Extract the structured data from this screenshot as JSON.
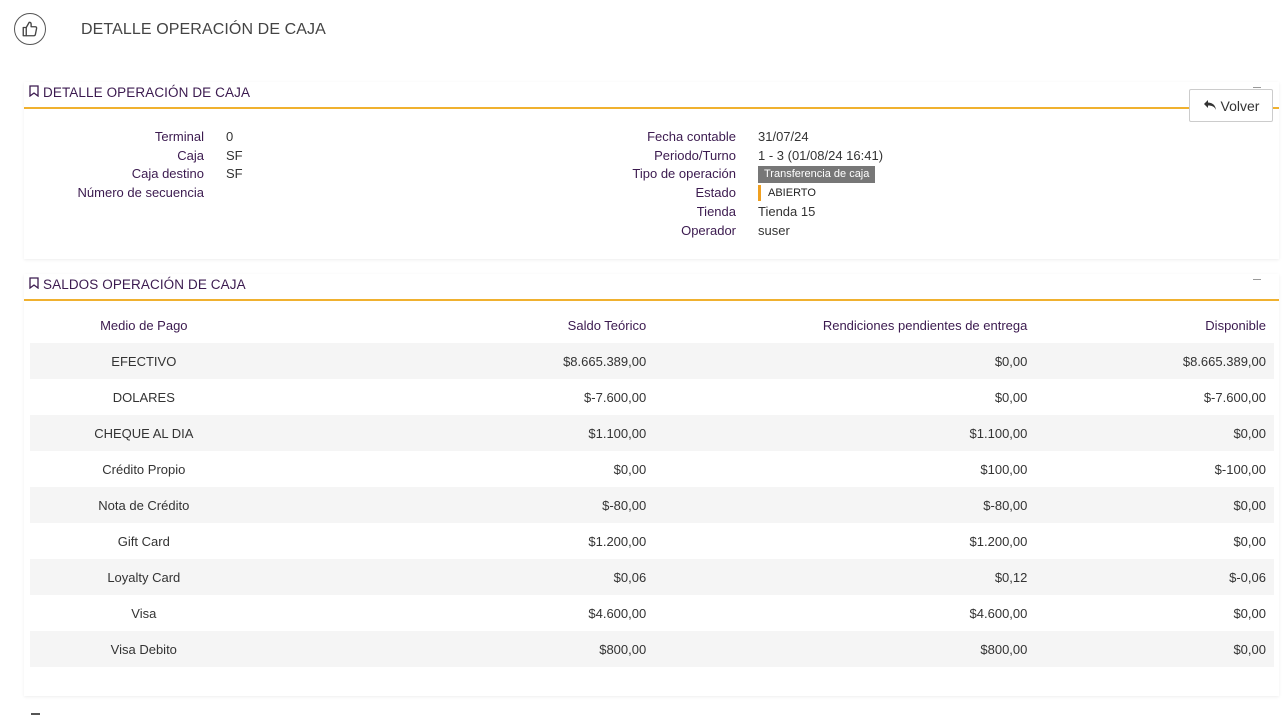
{
  "header": {
    "title": "DETALLE OPERACIÓN DE CAJA"
  },
  "detail_panel": {
    "title": "DETALLE OPERACIÓN DE CAJA",
    "volver_label": "Volver",
    "left_fields": [
      {
        "label": "Terminal",
        "value": "0"
      },
      {
        "label": "Caja",
        "value": "SF"
      },
      {
        "label": "Caja destino",
        "value": "SF"
      },
      {
        "label": "Número de secuencia",
        "value": ""
      }
    ],
    "right_fields": [
      {
        "label": "Fecha contable",
        "value": "31/07/24"
      },
      {
        "label": "Periodo/Turno",
        "value": "1 - 3 (01/08/24 16:41)"
      },
      {
        "label": "Tipo de operación",
        "value": "Transferencia de caja"
      },
      {
        "label": "Estado",
        "value": "ABIERTO"
      },
      {
        "label": "Tienda",
        "value": "Tienda 15"
      },
      {
        "label": "Operador",
        "value": "suser"
      }
    ]
  },
  "saldos_panel": {
    "title": "SALDOS OPERACIÓN DE CAJA",
    "columns": [
      "Medio de Pago",
      "Saldo Teórico",
      "Rendiciones pendientes de entrega",
      "Disponible"
    ],
    "rows": [
      [
        "EFECTIVO",
        "$8.665.389,00",
        "$0,00",
        "$8.665.389,00"
      ],
      [
        "DOLARES",
        "$-7.600,00",
        "$0,00",
        "$-7.600,00"
      ],
      [
        "CHEQUE AL DIA",
        "$1.100,00",
        "$1.100,00",
        "$0,00"
      ],
      [
        "Crédito Propio",
        "$0,00",
        "$100,00",
        "$-100,00"
      ],
      [
        "Nota de Crédito",
        "$-80,00",
        "$-80,00",
        "$0,00"
      ],
      [
        "Gift Card",
        "$1.200,00",
        "$1.200,00",
        "$0,00"
      ],
      [
        "Loyalty Card",
        "$0,06",
        "$0,12",
        "$-0,06"
      ],
      [
        "Visa",
        "$4.600,00",
        "$4.600,00",
        "$0,00"
      ],
      [
        "Visa Debito",
        "$800,00",
        "$800,00",
        "$0,00"
      ]
    ]
  },
  "colors": {
    "accent": "#f0b12f",
    "label": "#3b1a4f",
    "badge_grey": "#777777",
    "status_open": "#f0a020"
  },
  "icons": {
    "header": "thumbs-up-icon",
    "section": "bookmark-icon",
    "volver": "reply-arrow-icon"
  }
}
